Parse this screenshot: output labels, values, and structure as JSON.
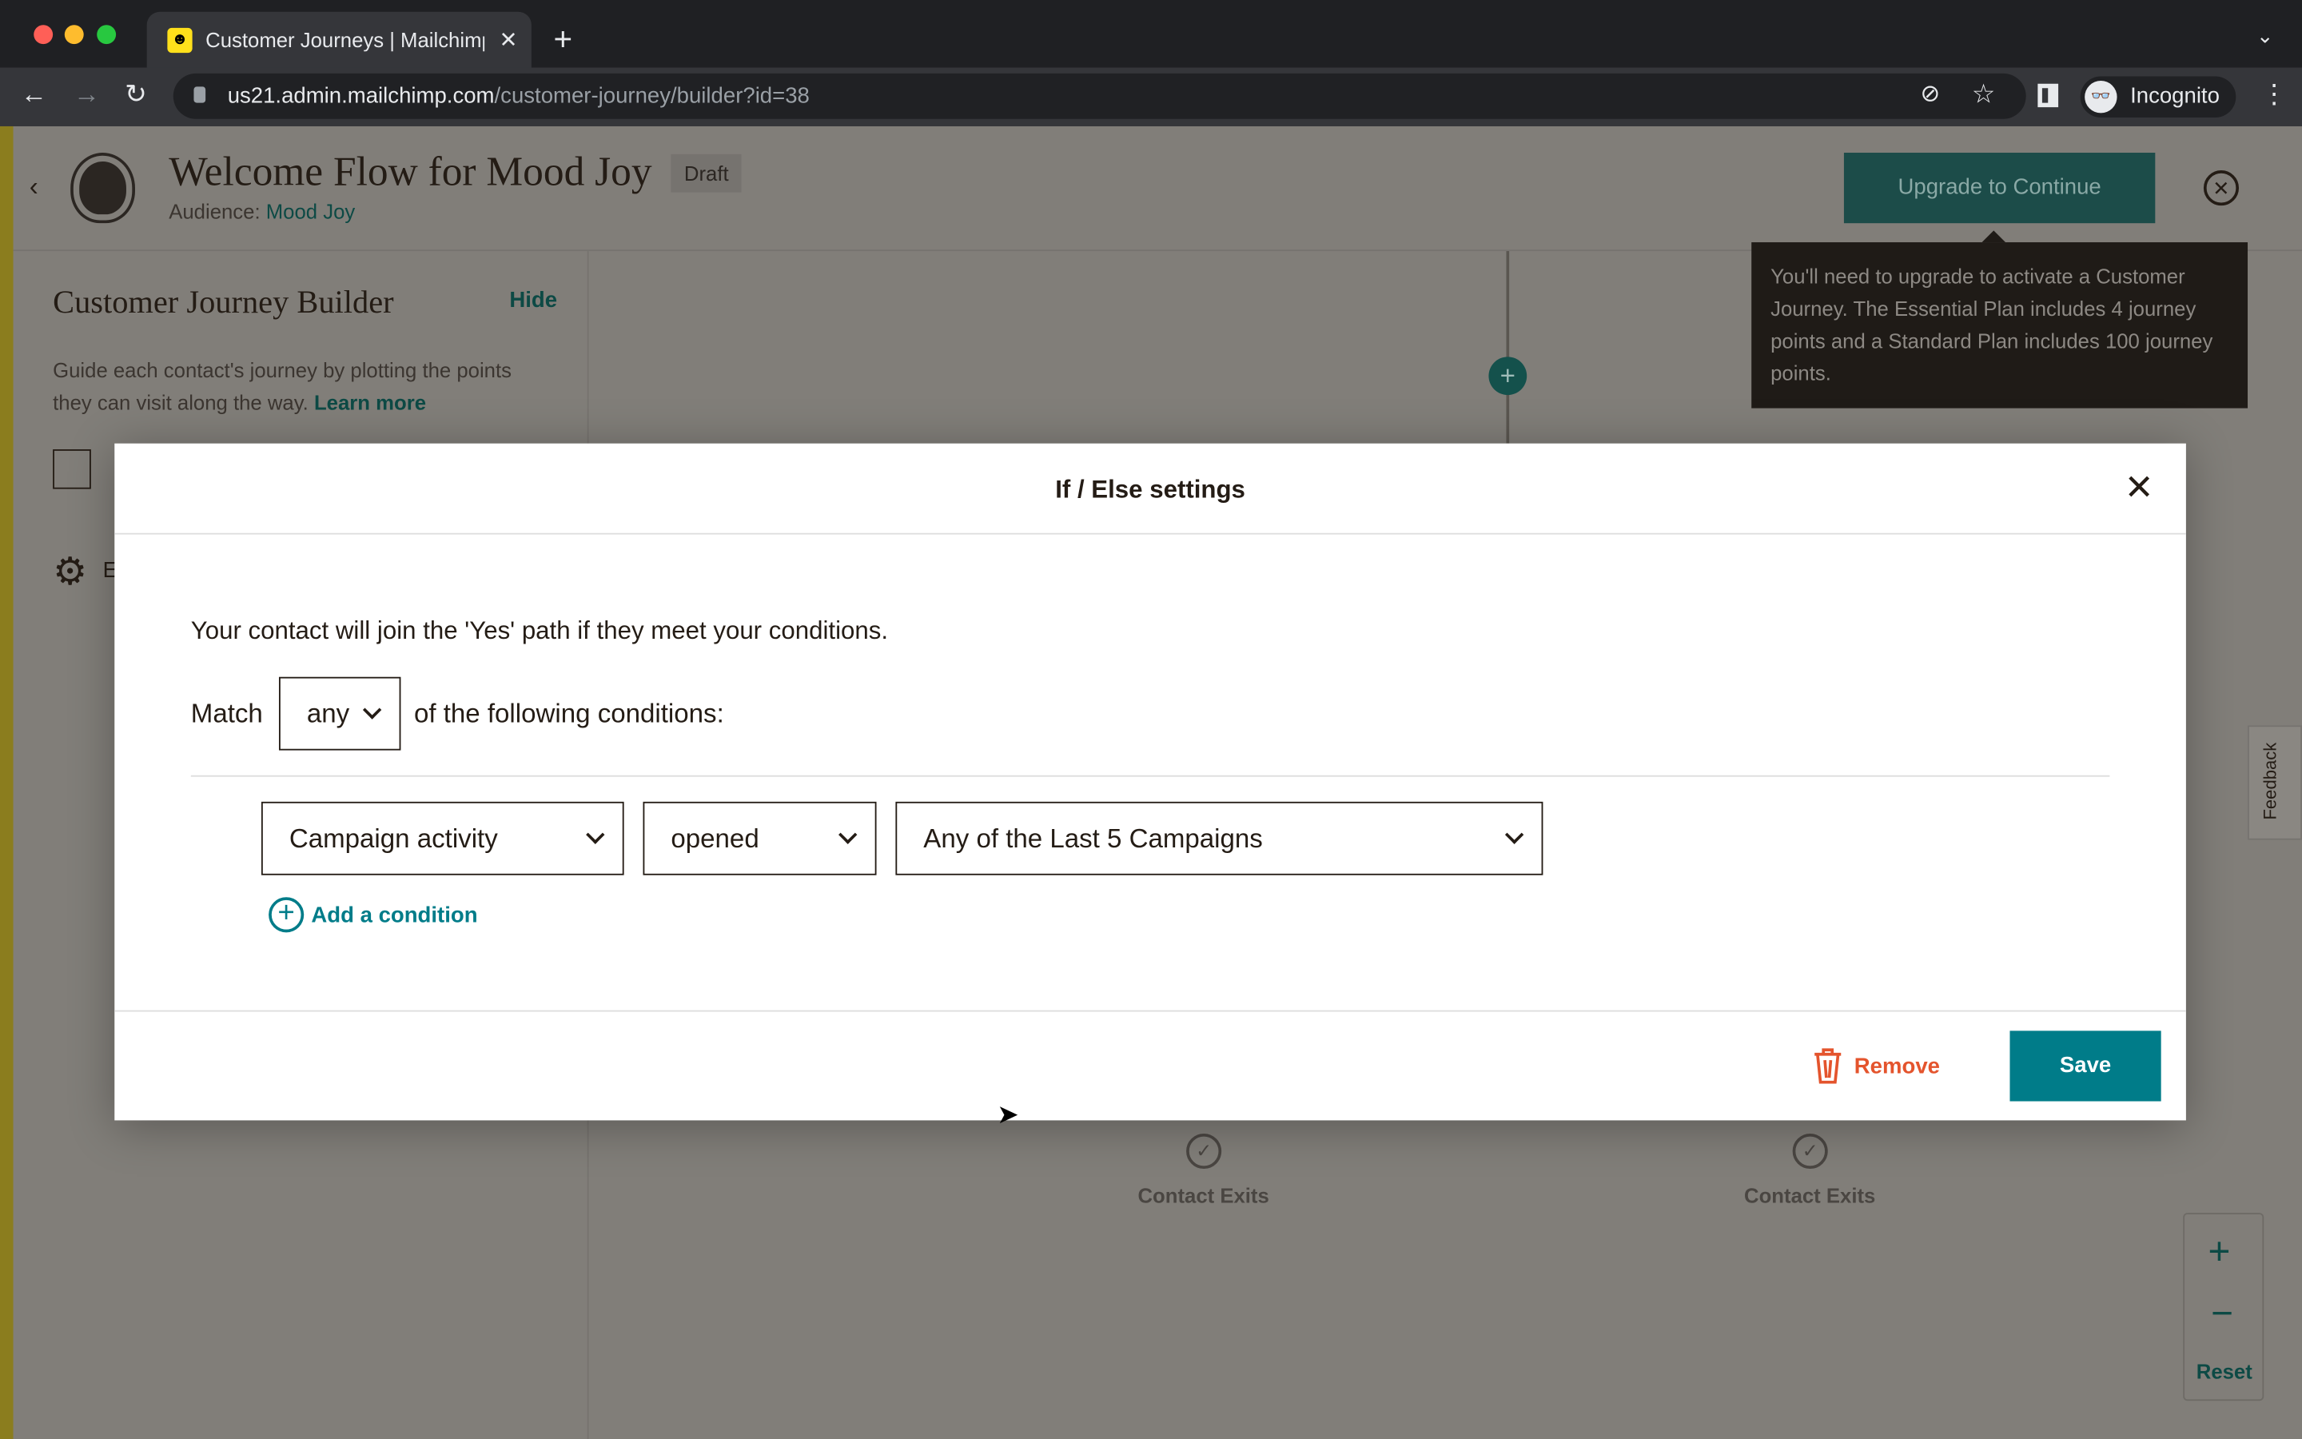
{
  "browser": {
    "tab_title": "Customer Journeys | Mailchimp",
    "url_host": "us21.admin.mailchimp.com",
    "url_path": "/customer-journey/builder?id=38",
    "profile_label": "Incognito"
  },
  "header": {
    "title": "Welcome Flow for Mood Joy",
    "status_badge": "Draft",
    "audience_label": "Audience:",
    "audience_name": "Mood Joy",
    "upgrade_button": "Upgrade to Continue"
  },
  "tooltip": {
    "text": "You'll need to upgrade to activate a Customer Journey. The Essential Plan includes 4 journey points and a Standard Plan includes 100 journey points."
  },
  "sidebar": {
    "title": "Customer Journey Builder",
    "hide_link": "Hide",
    "description": "Guide each contact's journey by plotting the points they can visit along the way.",
    "learn_more": "Learn more",
    "settings_label": "E"
  },
  "canvas": {
    "exit_labels": [
      "Contact Exits",
      "Contact Exits"
    ],
    "zoom_reset": "Reset",
    "feedback_tab": "Feedback"
  },
  "modal": {
    "title": "If / Else settings",
    "intro": "Your contact will join the 'Yes' path if they meet your conditions.",
    "match_label": "Match",
    "match_value": "any",
    "match_suffix": "of the following conditions:",
    "condition": {
      "field": "Campaign activity",
      "operator": "opened",
      "value": "Any of the Last 5 Campaigns"
    },
    "add_condition": "Add a condition",
    "remove_button": "Remove",
    "save_button": "Save"
  },
  "colors": {
    "primary": "#007c89",
    "remove": "#e4542d",
    "overlay": "#817e79"
  }
}
